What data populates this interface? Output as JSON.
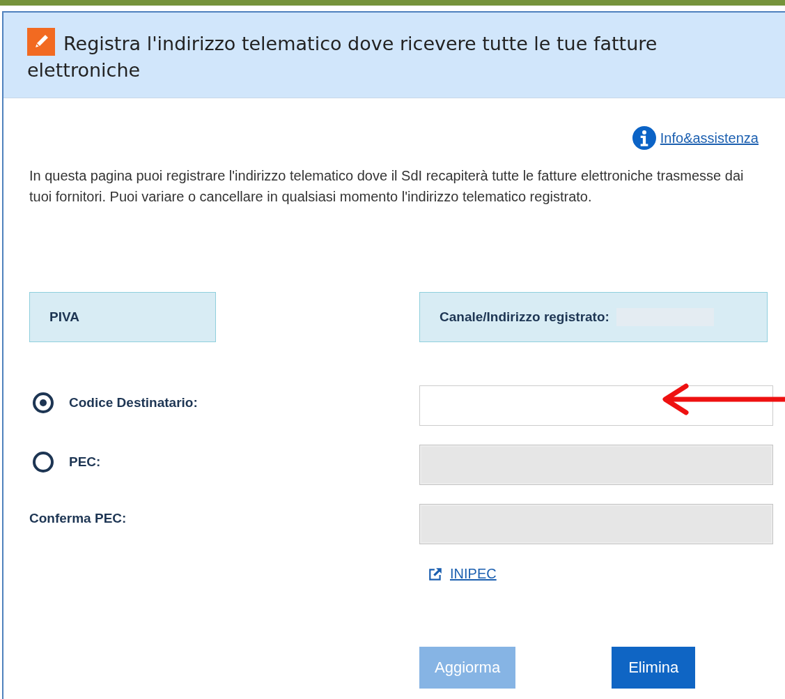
{
  "header": {
    "title": "Registra l'indirizzo telematico dove ricevere tutte le tue fatture elettroniche"
  },
  "info_link": "Info&assistenza",
  "intro": "In questa pagina puoi registrare l'indirizzo telematico dove il SdI recapiterà tutte le fatture elettroniche trasmesse dai tuoi fornitori. Puoi variare o cancellare in qualsiasi momento l'indirizzo telematico registrato.",
  "summary": {
    "piva_label": "PIVA",
    "channel_label": "Canale/Indirizzo registrato:"
  },
  "fields": [
    {
      "kind": "radio",
      "label": "Codice Destinatario:",
      "selected": true,
      "disabled": false
    },
    {
      "kind": "radio",
      "label": "PEC:",
      "selected": false,
      "disabled": true
    },
    {
      "kind": "plain",
      "label": "Conferma PEC:",
      "disabled": true
    }
  ],
  "external_link": "INIPEC",
  "buttons": [
    {
      "label": "Aggiorma",
      "disabled": true
    },
    {
      "label": "Elimina",
      "disabled": false
    }
  ]
}
